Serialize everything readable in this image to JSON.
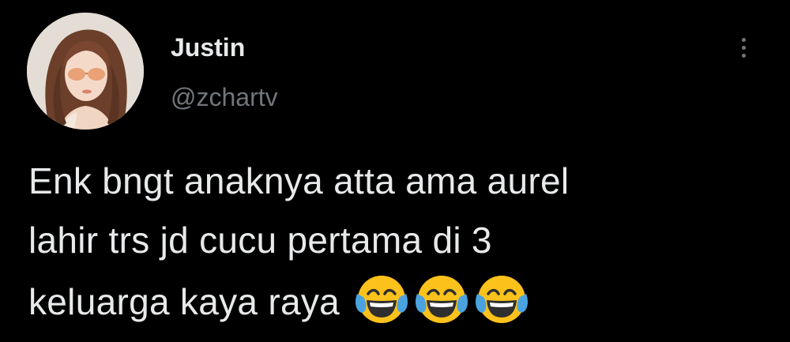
{
  "author": {
    "name": "Justin",
    "handle": "@zchartv"
  },
  "tweet": {
    "lines": [
      "Enk bngt anaknya atta ama aurel",
      "lahir trs jd cucu pertama di 3",
      "keluarga kaya raya"
    ],
    "emojis": [
      "face-with-tears-of-joy",
      "face-with-tears-of-joy",
      "face-with-tears-of-joy"
    ]
  },
  "icons": {
    "more": "more-vertical-icon"
  },
  "colors": {
    "background": "#000000",
    "text": "#e7e9ea",
    "muted": "#71767b",
    "emoji_face": "#fcc21b",
    "emoji_tears": "#4aa3df"
  }
}
